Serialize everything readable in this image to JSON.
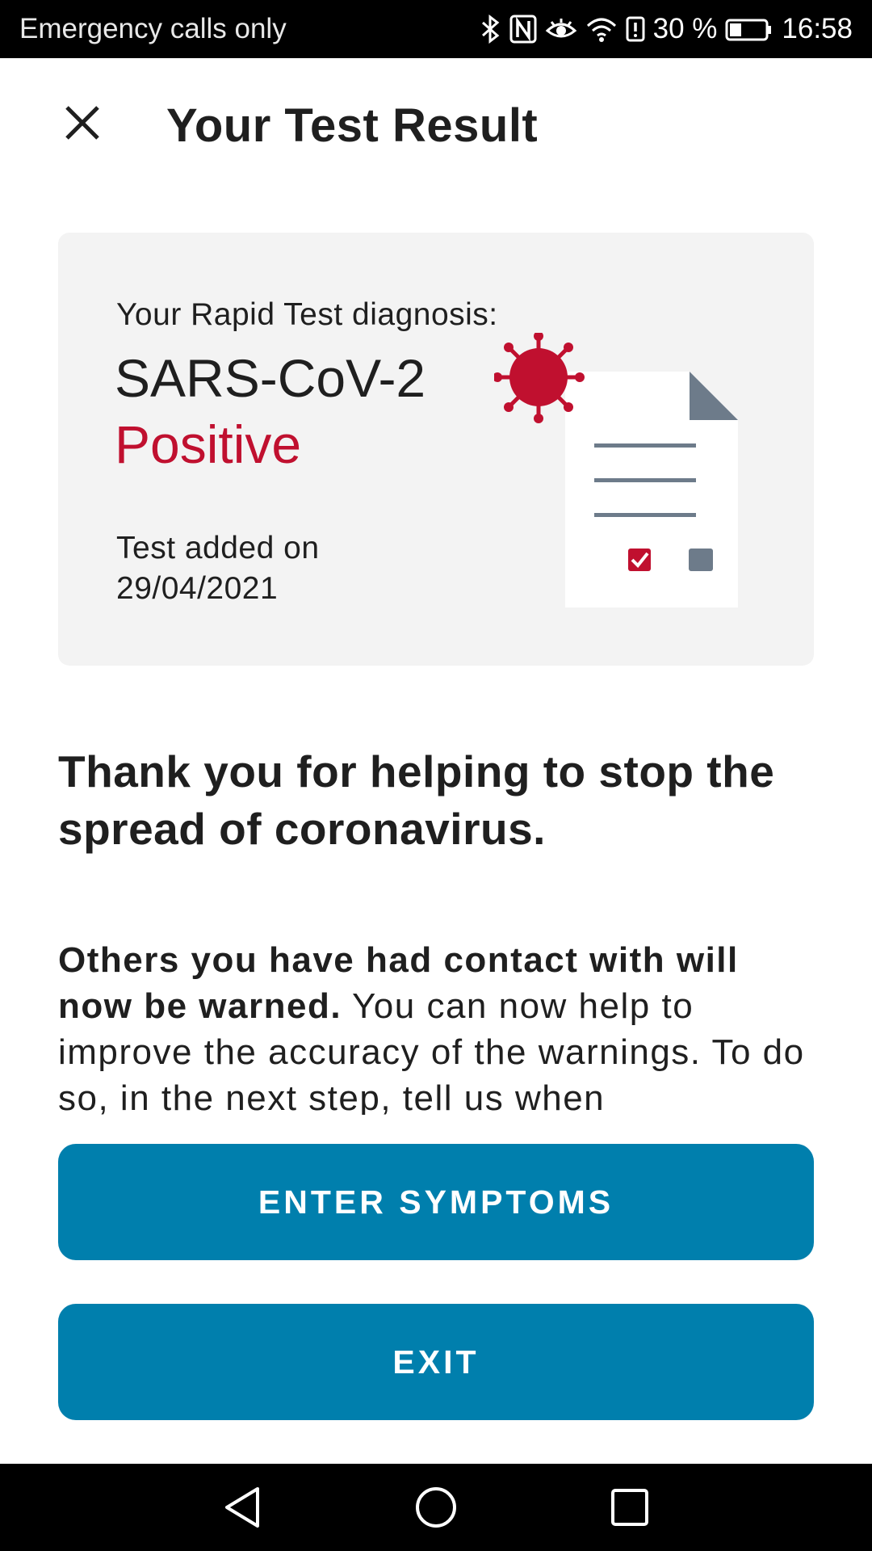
{
  "status_bar": {
    "carrier": "Emergency calls only",
    "battery_percent": "30 %",
    "time": "16:58",
    "icons": [
      "bluetooth-icon",
      "nfc-icon",
      "eye-comfort-icon",
      "wifi-icon",
      "battery-alert-icon",
      "battery-icon"
    ]
  },
  "header": {
    "title": "Your Test Result",
    "close_icon": "close-icon"
  },
  "result_card": {
    "label": "Your Rapid Test diagnosis:",
    "pathogen": "SARS-CoV-2",
    "result": "Positive",
    "date_label": "Test added on",
    "date": "29/04/2021",
    "illustration": "virus-document-icon"
  },
  "message": {
    "headline": "Thank you for helping to stop the spread of coronavirus.",
    "body_bold": "Others you have had contact with will now be warned.",
    "body_rest": " You can now help to improve the accuracy of the warnings. To do so, in the next step, tell us when"
  },
  "actions": {
    "enter_symptoms_label": "ENTER SYMPTOMS",
    "exit_label": "EXIT"
  },
  "nav_bar": {
    "icons": [
      "back-icon",
      "home-icon",
      "recent-apps-icon"
    ]
  },
  "colors": {
    "accent": "#007fad",
    "positive": "#c0102f",
    "card_background": "#f3f3f3",
    "text": "#1f1f1f"
  }
}
